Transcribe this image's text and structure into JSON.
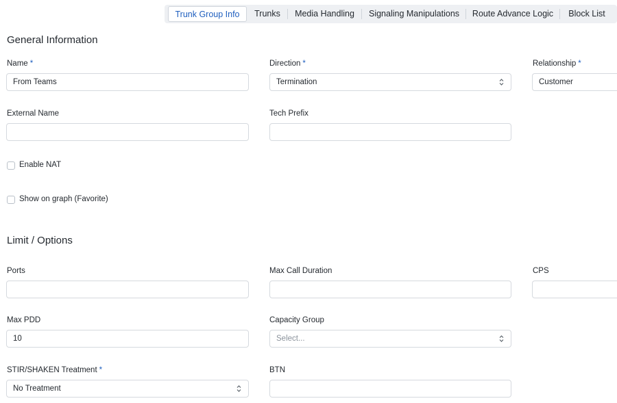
{
  "tabs": [
    {
      "label": "Trunk Group Info",
      "active": true
    },
    {
      "label": "Trunks",
      "active": false
    },
    {
      "label": "Media Handling",
      "active": false
    },
    {
      "label": "Signaling Manipulations",
      "active": false
    },
    {
      "label": "Route Advance Logic",
      "active": false
    },
    {
      "label": "Block List",
      "active": false
    }
  ],
  "general": {
    "title": "General Information",
    "name": {
      "label": "Name",
      "required": "*",
      "value": "From Teams"
    },
    "direction": {
      "label": "Direction",
      "required": "*",
      "value": "Termination"
    },
    "relationship": {
      "label": "Relationship",
      "required": "*",
      "value": "Customer"
    },
    "external_name": {
      "label": "External Name",
      "value": ""
    },
    "tech_prefix": {
      "label": "Tech Prefix",
      "value": ""
    },
    "enable_nat": {
      "label": "Enable NAT",
      "checked": false
    },
    "show_on_graph": {
      "label": "Show on graph (Favorite)",
      "checked": false
    }
  },
  "limits": {
    "title": "Limit / Options",
    "ports": {
      "label": "Ports",
      "value": ""
    },
    "max_call_duration": {
      "label": "Max Call Duration",
      "value": ""
    },
    "cps": {
      "label": "CPS",
      "value": ""
    },
    "max_pdd": {
      "label": "Max PDD",
      "value": "10"
    },
    "capacity_group": {
      "label": "Capacity Group",
      "placeholder": "Select..."
    },
    "stir_shaken": {
      "label": "STIR/SHAKEN Treatment",
      "required": "*",
      "value": "No Treatment"
    },
    "btn": {
      "label": "BTN",
      "value": ""
    }
  },
  "colors": {
    "accent": "#1f5fbf",
    "tab_bar": "#eef0f3",
    "border": "#d5d9de"
  }
}
